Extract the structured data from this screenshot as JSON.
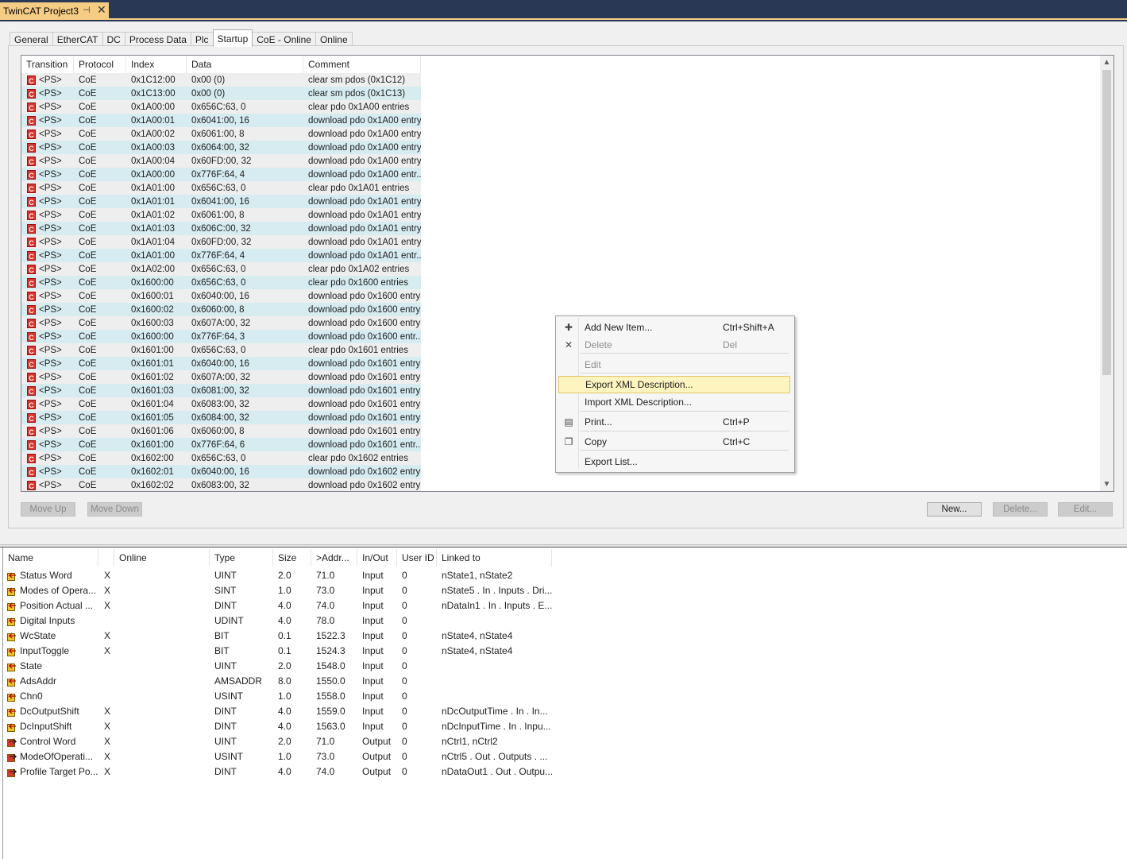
{
  "document_tab": {
    "title": "TwinCAT Project3",
    "pin_glyph": "⊣",
    "close_glyph": "✕"
  },
  "tabs": [
    "General",
    "EtherCAT",
    "DC",
    "Process Data",
    "Plc",
    "Startup",
    "CoE - Online",
    "Online"
  ],
  "active_tab": "Startup",
  "startup_table": {
    "columns": [
      "Transition",
      "Protocol",
      "Index",
      "Data",
      "Comment"
    ],
    "rows": [
      [
        "<PS>",
        "CoE",
        "0x1C12:00",
        "0x00 (0)",
        "clear sm pdos (0x1C12)"
      ],
      [
        "<PS>",
        "CoE",
        "0x1C13:00",
        "0x00 (0)",
        "clear sm pdos (0x1C13)"
      ],
      [
        "<PS>",
        "CoE",
        "0x1A00:00",
        "0x656C:63, 0",
        "clear pdo 0x1A00 entries"
      ],
      [
        "<PS>",
        "CoE",
        "0x1A00:01",
        "0x6041:00, 16",
        "download pdo 0x1A00 entry"
      ],
      [
        "<PS>",
        "CoE",
        "0x1A00:02",
        "0x6061:00, 8",
        "download pdo 0x1A00 entry"
      ],
      [
        "<PS>",
        "CoE",
        "0x1A00:03",
        "0x6064:00, 32",
        "download pdo 0x1A00 entry"
      ],
      [
        "<PS>",
        "CoE",
        "0x1A00:04",
        "0x60FD:00, 32",
        "download pdo 0x1A00 entry"
      ],
      [
        "<PS>",
        "CoE",
        "0x1A00:00",
        "0x776F:64, 4",
        "download pdo 0x1A00 entr..."
      ],
      [
        "<PS>",
        "CoE",
        "0x1A01:00",
        "0x656C:63, 0",
        "clear pdo 0x1A01 entries"
      ],
      [
        "<PS>",
        "CoE",
        "0x1A01:01",
        "0x6041:00, 16",
        "download pdo 0x1A01 entry"
      ],
      [
        "<PS>",
        "CoE",
        "0x1A01:02",
        "0x6061:00, 8",
        "download pdo 0x1A01 entry"
      ],
      [
        "<PS>",
        "CoE",
        "0x1A01:03",
        "0x606C:00, 32",
        "download pdo 0x1A01 entry"
      ],
      [
        "<PS>",
        "CoE",
        "0x1A01:04",
        "0x60FD:00, 32",
        "download pdo 0x1A01 entry"
      ],
      [
        "<PS>",
        "CoE",
        "0x1A01:00",
        "0x776F:64, 4",
        "download pdo 0x1A01 entr..."
      ],
      [
        "<PS>",
        "CoE",
        "0x1A02:00",
        "0x656C:63, 0",
        "clear pdo 0x1A02 entries"
      ],
      [
        "<PS>",
        "CoE",
        "0x1600:00",
        "0x656C:63, 0",
        "clear pdo 0x1600 entries"
      ],
      [
        "<PS>",
        "CoE",
        "0x1600:01",
        "0x6040:00, 16",
        "download pdo 0x1600 entry"
      ],
      [
        "<PS>",
        "CoE",
        "0x1600:02",
        "0x6060:00, 8",
        "download pdo 0x1600 entry"
      ],
      [
        "<PS>",
        "CoE",
        "0x1600:03",
        "0x607A:00, 32",
        "download pdo 0x1600 entry"
      ],
      [
        "<PS>",
        "CoE",
        "0x1600:00",
        "0x776F:64, 3",
        "download pdo 0x1600 entr..."
      ],
      [
        "<PS>",
        "CoE",
        "0x1601:00",
        "0x656C:63, 0",
        "clear pdo 0x1601 entries"
      ],
      [
        "<PS>",
        "CoE",
        "0x1601:01",
        "0x6040:00, 16",
        "download pdo 0x1601 entry"
      ],
      [
        "<PS>",
        "CoE",
        "0x1601:02",
        "0x607A:00, 32",
        "download pdo 0x1601 entry"
      ],
      [
        "<PS>",
        "CoE",
        "0x1601:03",
        "0x6081:00, 32",
        "download pdo 0x1601 entry"
      ],
      [
        "<PS>",
        "CoE",
        "0x1601:04",
        "0x6083:00, 32",
        "download pdo 0x1601 entry"
      ],
      [
        "<PS>",
        "CoE",
        "0x1601:05",
        "0x6084:00, 32",
        "download pdo 0x1601 entry"
      ],
      [
        "<PS>",
        "CoE",
        "0x1601:06",
        "0x6060:00, 8",
        "download pdo 0x1601 entry"
      ],
      [
        "<PS>",
        "CoE",
        "0x1601:00",
        "0x776F:64, 6",
        "download pdo 0x1601 entr..."
      ],
      [
        "<PS>",
        "CoE",
        "0x1602:00",
        "0x656C:63, 0",
        "clear pdo 0x1602 entries"
      ],
      [
        "<PS>",
        "CoE",
        "0x1602:01",
        "0x6040:00, 16",
        "download pdo 0x1602 entry"
      ],
      [
        "<PS>",
        "CoE",
        "0x1602:02",
        "0x6083:00, 32",
        "download pdo 0x1602 entry"
      ]
    ],
    "row_icon_letter": "C"
  },
  "buttons": {
    "move_up": "Move Up",
    "move_down": "Move Down",
    "new": "New...",
    "delete": "Delete...",
    "edit": "Edit..."
  },
  "context_menu": {
    "items": [
      {
        "label": "Add New Item...",
        "shortcut": "Ctrl+Shift+A",
        "icon": "add-item-icon",
        "enabled": true
      },
      {
        "label": "Delete",
        "shortcut": "Del",
        "icon": "delete-x-icon",
        "enabled": false
      },
      {
        "label": "Edit",
        "shortcut": "",
        "icon": "",
        "enabled": false
      },
      {
        "label": "Export XML Description...",
        "shortcut": "",
        "icon": "",
        "enabled": true,
        "highlighted": true
      },
      {
        "label": "Import XML Description...",
        "shortcut": "",
        "icon": "",
        "enabled": true
      },
      {
        "label": "Print...",
        "shortcut": "Ctrl+P",
        "icon": "printer-icon",
        "enabled": true
      },
      {
        "label": "Copy",
        "shortcut": "Ctrl+C",
        "icon": "copy-icon",
        "enabled": true
      },
      {
        "label": "Export List...",
        "shortcut": "",
        "icon": "",
        "enabled": true
      }
    ]
  },
  "variables_table": {
    "columns": [
      "Name",
      "",
      "Online",
      "Type",
      "Size",
      ">Addr...",
      "In/Out",
      "User ID",
      "Linked to"
    ],
    "rows": [
      {
        "name": "Status Word",
        "x": "X",
        "online": "",
        "type": "UINT",
        "size": "2.0",
        "addr": "71.0",
        "io": "Input",
        "uid": "0",
        "linked": "nState1, nState2",
        "kind": "input"
      },
      {
        "name": "Modes of Opera...",
        "x": "X",
        "online": "",
        "type": "SINT",
        "size": "1.0",
        "addr": "73.0",
        "io": "Input",
        "uid": "0",
        "linked": "nState5 . In . Inputs . Dri...",
        "kind": "input"
      },
      {
        "name": "Position Actual ...",
        "x": "X",
        "online": "",
        "type": "DINT",
        "size": "4.0",
        "addr": "74.0",
        "io": "Input",
        "uid": "0",
        "linked": "nDataIn1 . In . Inputs . E...",
        "kind": "input"
      },
      {
        "name": "Digital Inputs",
        "x": "",
        "online": "",
        "type": "UDINT",
        "size": "4.0",
        "addr": "78.0",
        "io": "Input",
        "uid": "0",
        "linked": "",
        "kind": "input"
      },
      {
        "name": "WcState",
        "x": "X",
        "online": "",
        "type": "BIT",
        "size": "0.1",
        "addr": "1522.3",
        "io": "Input",
        "uid": "0",
        "linked": "nState4, nState4",
        "kind": "input"
      },
      {
        "name": "InputToggle",
        "x": "X",
        "online": "",
        "type": "BIT",
        "size": "0.1",
        "addr": "1524.3",
        "io": "Input",
        "uid": "0",
        "linked": "nState4, nState4",
        "kind": "input"
      },
      {
        "name": "State",
        "x": "",
        "online": "",
        "type": "UINT",
        "size": "2.0",
        "addr": "1548.0",
        "io": "Input",
        "uid": "0",
        "linked": "",
        "kind": "input"
      },
      {
        "name": "AdsAddr",
        "x": "",
        "online": "",
        "type": "AMSADDR",
        "size": "8.0",
        "addr": "1550.0",
        "io": "Input",
        "uid": "0",
        "linked": "",
        "kind": "input"
      },
      {
        "name": "Chn0",
        "x": "",
        "online": "",
        "type": "USINT",
        "size": "1.0",
        "addr": "1558.0",
        "io": "Input",
        "uid": "0",
        "linked": "",
        "kind": "input"
      },
      {
        "name": "DcOutputShift",
        "x": "X",
        "online": "",
        "type": "DINT",
        "size": "4.0",
        "addr": "1559.0",
        "io": "Input",
        "uid": "0",
        "linked": "nDcOutputTime . In . In...",
        "kind": "input"
      },
      {
        "name": "DcInputShift",
        "x": "X",
        "online": "",
        "type": "DINT",
        "size": "4.0",
        "addr": "1563.0",
        "io": "Input",
        "uid": "0",
        "linked": "nDcInputTime . In . Inpu...",
        "kind": "input"
      },
      {
        "name": "Control Word",
        "x": "X",
        "online": "",
        "type": "UINT",
        "size": "2.0",
        "addr": "71.0",
        "io": "Output",
        "uid": "0",
        "linked": "nCtrl1, nCtrl2",
        "kind": "output"
      },
      {
        "name": "ModeOfOperati...",
        "x": "X",
        "online": "",
        "type": "USINT",
        "size": "1.0",
        "addr": "73.0",
        "io": "Output",
        "uid": "0",
        "linked": "nCtrl5 . Out . Outputs . ...",
        "kind": "output"
      },
      {
        "name": "Profile Target Po...",
        "x": "X",
        "online": "",
        "type": "DINT",
        "size": "4.0",
        "addr": "74.0",
        "io": "Output",
        "uid": "0",
        "linked": "nDataOut1 . Out . Outpu...",
        "kind": "output"
      }
    ]
  }
}
